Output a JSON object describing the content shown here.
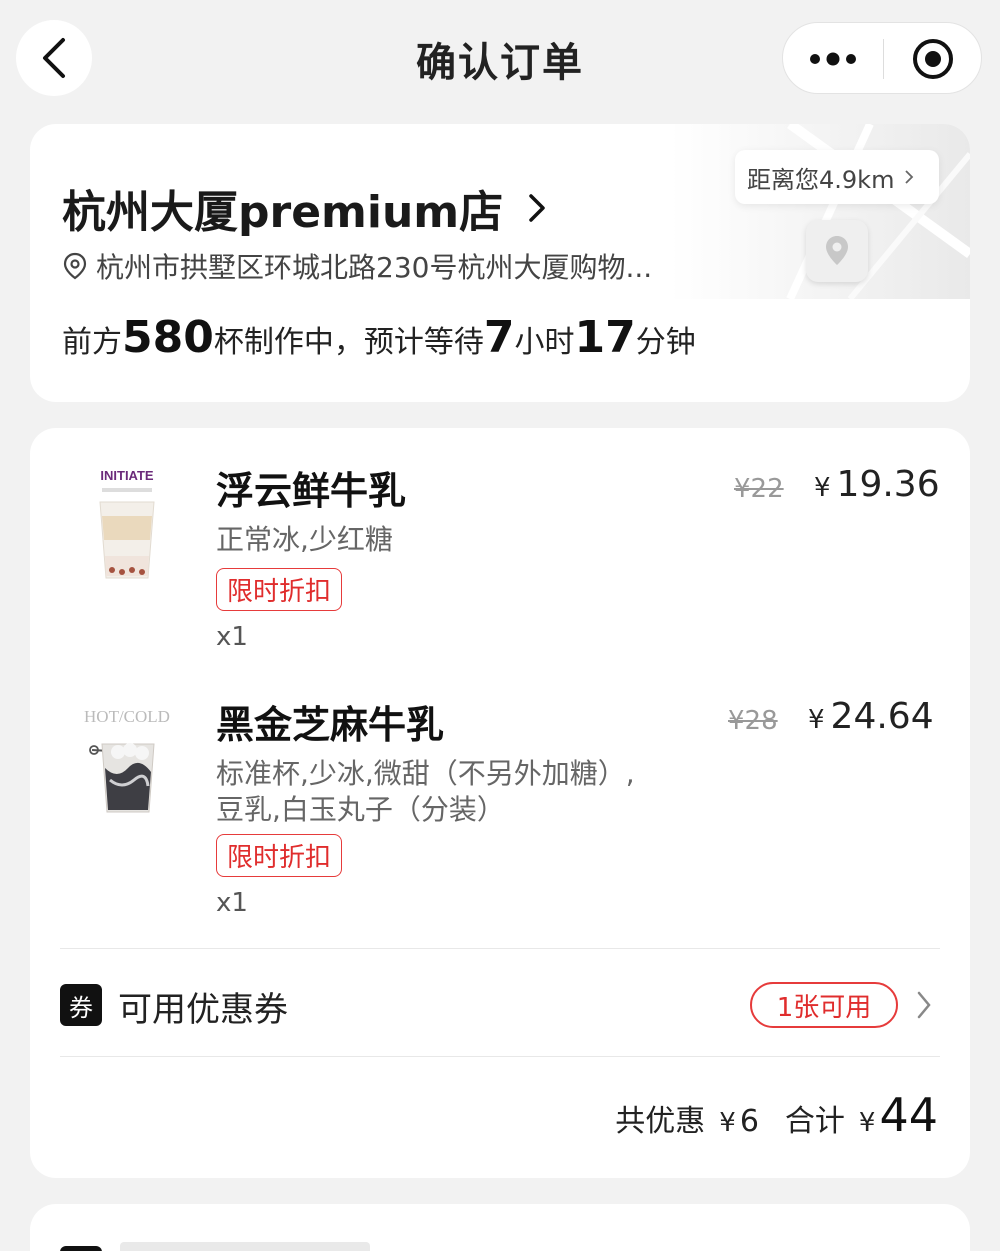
{
  "header": {
    "title": "确认订单",
    "back_icon": "chevron-left-icon",
    "more_icon": "more-dots-icon",
    "target_icon": "target-icon"
  },
  "store": {
    "name": "杭州大厦premium店",
    "address": "杭州市拱墅区环城北路230号杭州大厦购物...",
    "distance": "距离您4.9km",
    "queue_prefix": "前方",
    "queue_count": "580",
    "queue_mid": "杯制作中，预计等待",
    "wait_hours": "7",
    "hours_unit": "小时",
    "wait_minutes": "17",
    "minutes_unit": "分钟"
  },
  "items": [
    {
      "name": "浮云鲜牛乳",
      "spec": "正常冰,少红糖",
      "tag": "限时折扣",
      "qty": "x1",
      "original_price": "¥22",
      "currency": "¥",
      "price": "19.36",
      "thumb_text": "INITIATE"
    },
    {
      "name": "黑金芝麻牛乳",
      "spec": "标准杯,少冰,微甜（不另外加糖）,豆乳,白玉丸子（分装）",
      "tag": "限时折扣",
      "qty": "x1",
      "original_price": "¥28",
      "currency": "¥",
      "price": "24.64",
      "thumb_text": "HOT/COLD"
    }
  ],
  "coupon": {
    "icon_text": "券",
    "label": "可用优惠券",
    "badge": "1张可用"
  },
  "totals": {
    "discount_label": "共优惠",
    "currency": "¥",
    "discount": "6",
    "total_label": "合计",
    "total": "44"
  },
  "colors": {
    "accent_red": "#e02d2d",
    "background": "#f2f2f2"
  }
}
